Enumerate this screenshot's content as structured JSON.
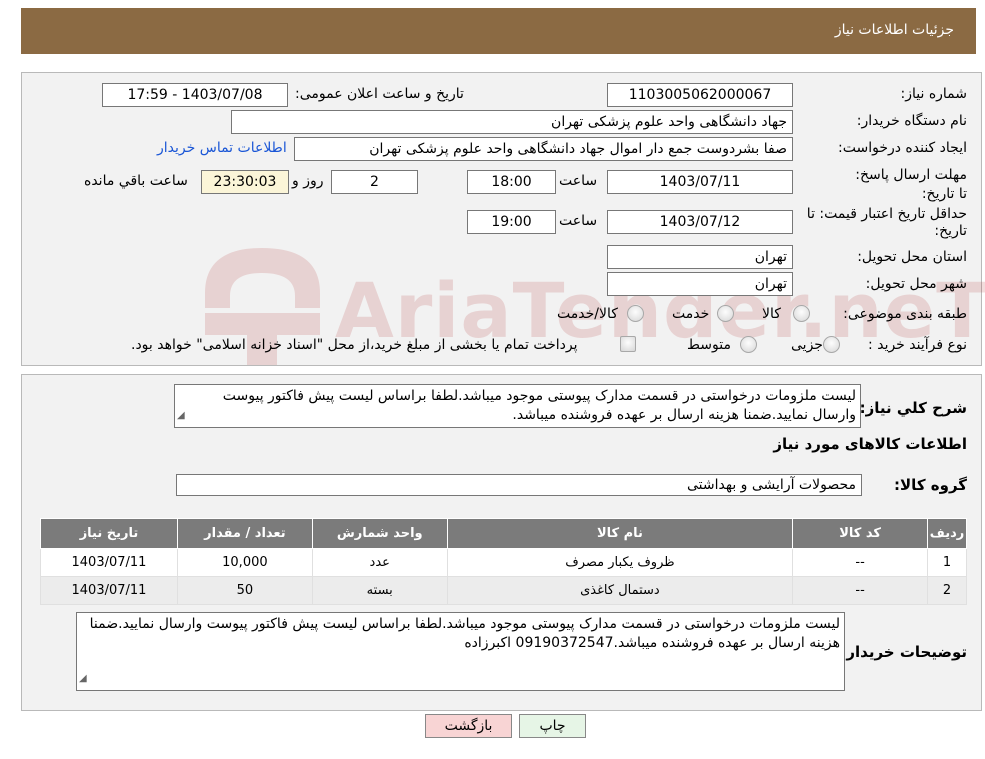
{
  "header": {
    "title": "جزئیات اطلاعات نیاز"
  },
  "need": {
    "number_label": "شماره نیاز:",
    "number_value": "1103005062000067",
    "announce_label": "تاریخ و ساعت اعلان عمومی:",
    "announce_value": "1403/07/08 - 17:59",
    "buyer_label": "نام دستگاه خریدار:",
    "buyer_value": "جهاد دانشگاهی واحد علوم پزشکی تهران",
    "creator_label": "ایجاد کننده درخواست:",
    "creator_value": "صفا بشردوست جمع دار اموال  جهاد دانشگاهی واحد علوم پزشکی تهران",
    "contact_link": "اطلاعات تماس خریدار",
    "deadline_label": "مهلت ارسال پاسخ: تا تاریخ:",
    "deadline_date": "1403/07/11",
    "time_word": "ساعت",
    "deadline_time": "18:00",
    "days_value": "2",
    "days_word": "روز و",
    "remaining_time": "23:30:03",
    "remaining_word": "ساعت باقي مانده",
    "validity_label": "حداقل تاریخ اعتبار قیمت: تا تاریخ:",
    "validity_date": "1403/07/12",
    "validity_time": "19:00",
    "province_label": "استان محل تحویل:",
    "province_value": "تهران",
    "city_label": "شهر محل تحویل:",
    "city_value": "تهران",
    "category_label": "طبقه بندی موضوعی:",
    "category_options": [
      "کالا",
      "خدمت",
      "کالا/خدمت"
    ],
    "process_label": "نوع فرآیند خرید :",
    "process_options": [
      "جزیی",
      "متوسط"
    ],
    "process_note": "پرداخت تمام یا بخشی از مبلغ خرید،از محل \"اسناد خزانه اسلامی\" خواهد بود."
  },
  "description": {
    "label": "شرح كلي نياز:",
    "text": "لیست ملزومات درخواستی در قسمت مدارک پیوستی موجود میباشد.لطفا براساس لیست پیش فاکتور پیوست وارسال نمایید.ضمنا هزینه ارسال بر عهده فروشنده میباشد."
  },
  "goods": {
    "title": "اطلاعات کالاهای مورد نیاز",
    "group_label": "گروه کالا:",
    "group_value": "محصولات آرایشی و بهداشتی",
    "columns": [
      "ردیف",
      "کد کالا",
      "نام کالا",
      "واحد شمارش",
      "تعداد / مقدار",
      "تاریخ نیاز"
    ],
    "rows": [
      [
        "1",
        "--",
        "ظروف یکبار مصرف",
        "عدد",
        "10,000",
        "1403/07/11"
      ],
      [
        "2",
        "--",
        "دستمال کاغذی",
        "بسته",
        "50",
        "1403/07/11"
      ]
    ]
  },
  "buyer_notes": {
    "label": "توضیحات خریدار:",
    "text": "لیست ملزومات درخواستی در قسمت مدارک پیوستی موجود میباشد.لطفا براساس لیست پیش فاکتور پیوست وارسال نمایید.ضمنا هزینه ارسال بر عهده فروشنده میباشد.09190372547 اکبرزاده"
  },
  "watermark": {
    "text": "AriaTender.neT"
  },
  "buttons": {
    "print": "چاپ",
    "back": "بازگشت"
  },
  "colors": {
    "header_bg": "#8b6a43",
    "table_header_bg": "#7b7b7b",
    "back_button_bg": "#f8d4d4",
    "print_button_bg": "#e6f5e6"
  }
}
